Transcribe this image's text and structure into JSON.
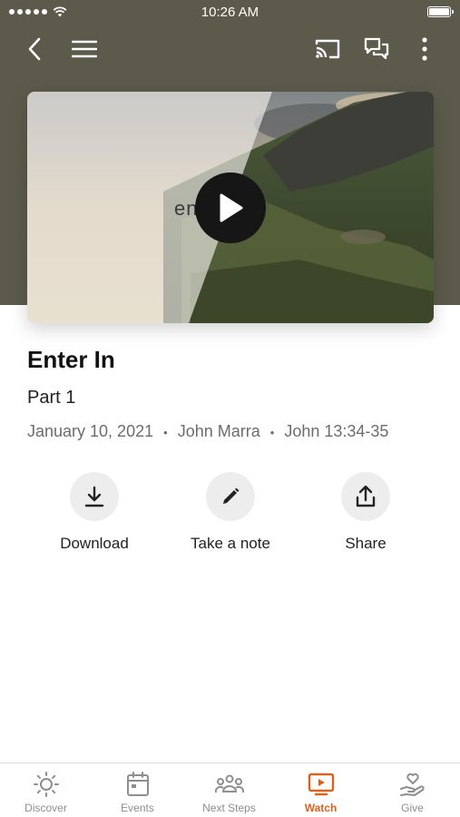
{
  "status_bar": {
    "time": "10:26 AM"
  },
  "nav": {
    "back_icon": "chevron-left-icon",
    "menu_icon": "hamburger-icon",
    "cast_icon": "cast-icon",
    "chat_icon": "chat-icon",
    "more_icon": "more-vertical-icon"
  },
  "video": {
    "caption": "enter in",
    "play_icon": "play-icon"
  },
  "sermon": {
    "title": "Enter In",
    "subtitle": "Part 1",
    "date": "January 10, 2021",
    "speaker": "John Marra",
    "scripture": "John 13:34-35",
    "separator": "•"
  },
  "actions": [
    {
      "label": "Download",
      "icon": "download-icon"
    },
    {
      "label": "Take a note",
      "icon": "pencil-icon"
    },
    {
      "label": "Share",
      "icon": "share-icon"
    }
  ],
  "tabs": [
    {
      "label": "Discover",
      "icon": "sun-icon"
    },
    {
      "label": "Events",
      "icon": "calendar-icon"
    },
    {
      "label": "Next Steps",
      "icon": "people-icon"
    },
    {
      "label": "Watch",
      "icon": "tv-play-icon",
      "active": true
    },
    {
      "label": "Give",
      "icon": "hand-heart-icon"
    }
  ],
  "colors": {
    "accent": "#d9631e",
    "hero": "#5c5b4b",
    "inactive": "#8e8e8e"
  }
}
